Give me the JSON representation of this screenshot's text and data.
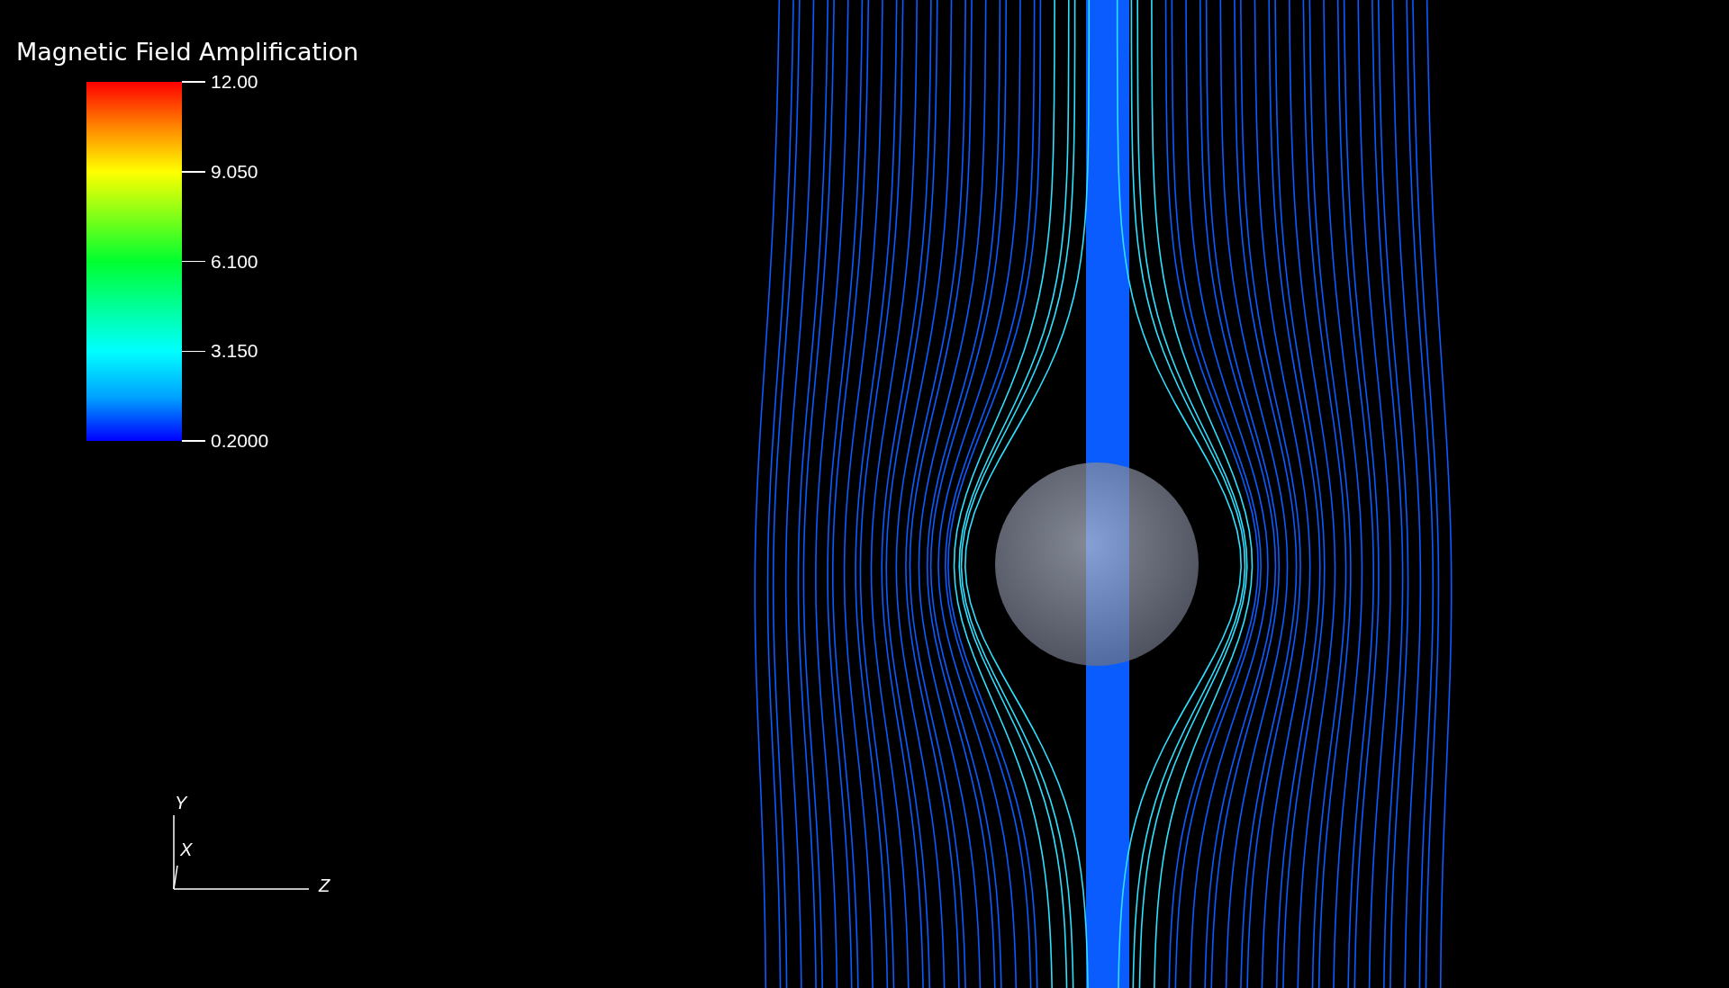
{
  "legend": {
    "title": "Magnetic Field Amplification",
    "ticks": [
      "12.00",
      "9.050",
      "6.100",
      "3.150",
      "0.2000"
    ]
  },
  "axes": {
    "y": "Y",
    "x": "X",
    "z": "Z"
  }
}
